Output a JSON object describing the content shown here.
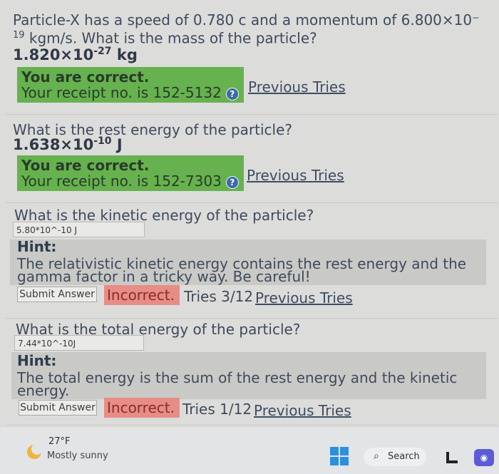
{
  "q1": {
    "text_line1": "Particle-X has a speed of 0.780 c and a momentum of 6.800×10⁻",
    "text_line2_sup": "19",
    "text_line2": " kgm/s. What is the mass of the particle?",
    "answer_base": "1.820×10",
    "answer_exp": "-27",
    "answer_unit": " kg",
    "correct_label": "You are correct.",
    "receipt": "Your receipt no. is 152-5132",
    "prev_tries": "Previous Tries"
  },
  "q2": {
    "text": "What is the rest energy of the particle?",
    "answer_base": "1.638×10",
    "answer_exp": "-10",
    "answer_unit": " J",
    "correct_label": "You are correct.",
    "receipt": "Your receipt no. is 152-7303",
    "prev_tries": "Previous Tries"
  },
  "q3": {
    "text": "What is the kinetic energy of the particle?",
    "input_value": "5.80*10^-10 J",
    "hint_title": "Hint:",
    "hint_line1": "The relativistic kinetic energy contains the rest energy and the",
    "hint_line2": "gamma factor in a tricky way. Be careful!",
    "submit_label": "Submit Answer",
    "status": "Incorrect.",
    "tries": "Tries 3/12",
    "prev_tries": "Previous Tries"
  },
  "q4": {
    "text": "What is the total energy of the particle?",
    "input_value": "7.44*10^-10J",
    "hint_title": "Hint:",
    "hint_line1": "The total energy is the sum of the rest energy and the kinetic",
    "hint_line2": "energy.",
    "submit_label": "Submit Answer",
    "status": "Incorrect.",
    "tries": "Tries 1/12",
    "prev_tries": "Previous Tries"
  },
  "taskbar": {
    "temperature": "27°F",
    "condition": "Mostly sunny",
    "search_label": "Search",
    "weather_icon": "sun-cloud-icon",
    "windows_icon": "windows-logo-icon",
    "search_icon": "search-icon"
  },
  "colors": {
    "correct_bg": "#66b24e",
    "incorrect_bg": "#e78d86",
    "hint_bg": "#c9c9c6"
  }
}
